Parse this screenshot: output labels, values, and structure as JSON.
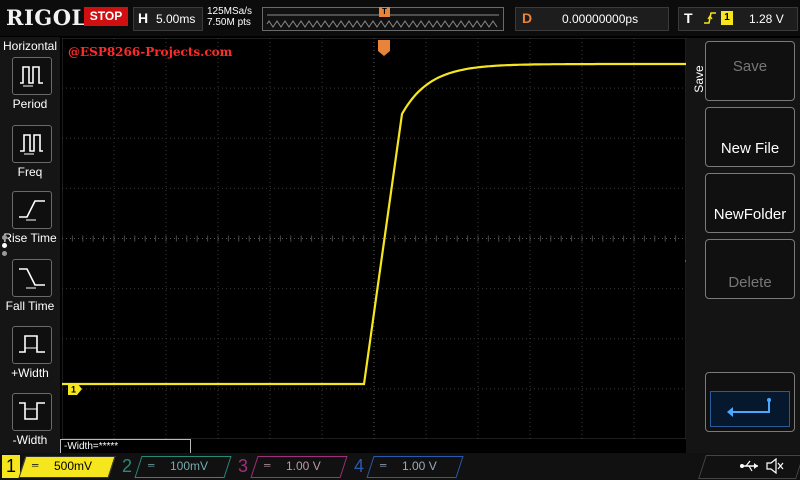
{
  "header": {
    "brand": "RIGOL",
    "run_state": "STOP",
    "horizontal_letter": "H",
    "timebase": "5.00ms",
    "sample_rate": "125MSa/s",
    "memory_depth": "7.50M pts",
    "trigger_marker": "T",
    "delay_letter": "D",
    "delay": "0.00000000ps",
    "trigger_letter": "T",
    "trigger_source": "1",
    "trigger_level": "1.28 V"
  },
  "left_menu": {
    "title": "Horizontal",
    "items": [
      {
        "label": "Period",
        "icon": "period-icon"
      },
      {
        "label": "Freq",
        "icon": "frequency-icon"
      },
      {
        "label": "Rise Time",
        "icon": "rise-time-icon"
      },
      {
        "label": "Fall Time",
        "icon": "fall-time-icon"
      },
      {
        "label": "+Width",
        "icon": "positive-width-icon"
      },
      {
        "label": "-Width",
        "icon": "negative-width-icon"
      }
    ]
  },
  "screen": {
    "watermark": "@ESP8266-Projects.com",
    "trigger_marker": "T",
    "ch1_reference": "1",
    "measurement": "-Width=*****",
    "trace_color": "#f5e61e"
  },
  "right_menu": {
    "title": "Save",
    "buttons": [
      "Save",
      "New File",
      "NewFolder",
      "Delete"
    ],
    "enter_icon": "enter-icon"
  },
  "channels": [
    {
      "num": "1",
      "coupling": "═",
      "scale": "500mV",
      "color": "#f5e61e"
    },
    {
      "num": "2",
      "coupling": "═",
      "scale": "100mV",
      "color": "#2a8a78"
    },
    {
      "num": "3",
      "coupling": "═",
      "scale": "1.00 V",
      "color": "#a0307a"
    },
    {
      "num": "4",
      "coupling": "═",
      "scale": "1.00 V",
      "color": "#2a5ab0"
    }
  ]
}
